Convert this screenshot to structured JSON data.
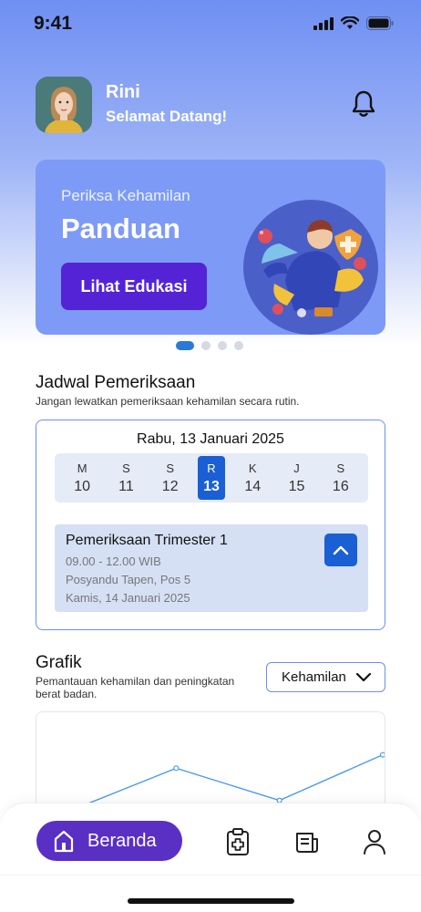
{
  "status_bar": {
    "time": "9:41"
  },
  "header": {
    "user_name": "Rini",
    "greeting": "Selamat Datang!"
  },
  "banner": {
    "subtitle": "Periksa Kehamilan",
    "title": "Panduan",
    "button_label": "Lihat Edukasi",
    "carousel_pages": 4,
    "active_page": 1
  },
  "schedule": {
    "title": "Jadwal Pemeriksaan",
    "description": "Jangan lewatkan pemeriksaan kehamilan secara rutin.",
    "current_date": "Rabu, 13 Januari 2025",
    "days": [
      {
        "letter": "M",
        "number": "10"
      },
      {
        "letter": "S",
        "number": "11"
      },
      {
        "letter": "S",
        "number": "12"
      },
      {
        "letter": "R",
        "number": "13",
        "selected": true
      },
      {
        "letter": "K",
        "number": "14"
      },
      {
        "letter": "J",
        "number": "15"
      },
      {
        "letter": "S",
        "number": "16"
      }
    ],
    "appointment": {
      "title": "Pemeriksaan Trimester 1",
      "time": "09.00 - 12.00 WIB",
      "location": "Posyandu Tapen, Pos 5",
      "date": "Kamis, 14 Januari 2025"
    }
  },
  "chart_section": {
    "title": "Grafik",
    "description_line1": "Pemantauan kehamilan dan peningkatan",
    "description_line2": "berat badan.",
    "dropdown_value": "Kehamilan"
  },
  "chart_data": {
    "type": "line",
    "title": "",
    "xlabel": "",
    "ylabel": "",
    "series": [
      {
        "values": [
          0.2,
          0.88,
          0.35,
          1.1
        ]
      }
    ],
    "grid": false
  },
  "bottom_nav": {
    "home_label": "Beranda"
  },
  "colors": {
    "primary": "#5a2fc4",
    "accent_blue": "#1a5fd4",
    "banner_bg": "#7d9af7",
    "line": "#4d9be6"
  }
}
